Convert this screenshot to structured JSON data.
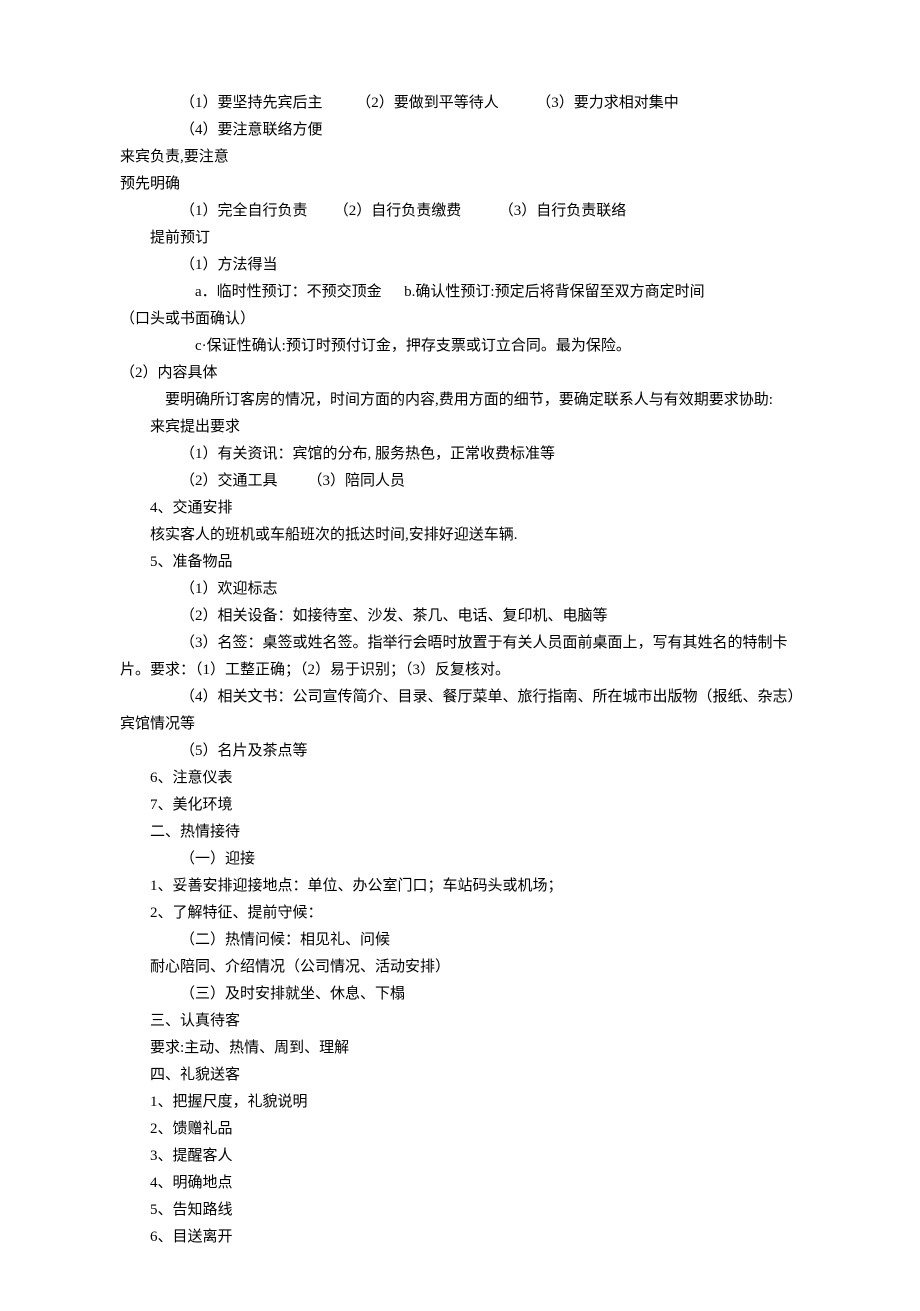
{
  "lines": [
    {
      "cls": "indent3",
      "text": "（1）要坚持先宾后主         （2）要做到平等待人          （3）要力求相对集中"
    },
    {
      "cls": "indent3",
      "text": "（4）要注意联络方便"
    },
    {
      "cls": "indent0",
      "text": "来宾负责,要注意"
    },
    {
      "cls": "indent0",
      "text": "预先明确"
    },
    {
      "cls": "indent3",
      "text": "（1）完全自行负责       （2）自行负责缴费          （3）自行负责联络"
    },
    {
      "cls": "indent1",
      "text": "提前预订"
    },
    {
      "cls": "indent3",
      "text": "（1）方法得当"
    },
    {
      "cls": "indent4",
      "text": "a．临时性预订：不预交顶金      b.确认性预订:预定后将背保留至双方商定时间"
    },
    {
      "cls": "indent0",
      "text": "（口头或书面确认）"
    },
    {
      "cls": "indent4",
      "text": "c·保证性确认:预订时预付订金，押存支票或订立合同。最为保险。"
    },
    {
      "cls": "indent0",
      "text": "（2）内容具体"
    },
    {
      "cls": "indent2",
      "text": "要明确所订客房的情况，时间方面的内容,费用方面的细节，要确定联系人与有效期要求协助:"
    },
    {
      "cls": "indent1",
      "text": "来宾提出要求"
    },
    {
      "cls": "indent3",
      "text": "（1）有关资讯：宾馆的分布, 服务热色，正常收费标准等"
    },
    {
      "cls": "indent3",
      "text": "（2）交通工具        （3）陪同人员"
    },
    {
      "cls": "indent1",
      "text": "4、交通安排"
    },
    {
      "cls": "indent1",
      "text": "核实客人的班机或车船班次的抵达时间,安排好迎送车辆."
    },
    {
      "cls": "indent1",
      "text": "5、准备物品"
    },
    {
      "cls": "indent3",
      "text": "（1）欢迎标志"
    },
    {
      "cls": "indent3",
      "text": "（2）相关设备：如接待室、沙发、茶几、电话、复印机、电脑等"
    },
    {
      "cls": "indent3",
      "text": "（3）名签：桌签或姓名签。指举行会晤时放置于有关人员面前桌面上，写有其姓名的特制卡"
    },
    {
      "cls": "indent0",
      "text": "片。要求：（1）工整正确；（2）易于识别；（3）反复核对。"
    },
    {
      "cls": "indent3",
      "text": "（4）相关文书：公司宣传简介、目录、餐厅菜单、旅行指南、所在城市出版物（报纸、杂志）"
    },
    {
      "cls": "indent0",
      "text": "宾馆情况等"
    },
    {
      "cls": "indent3",
      "text": "（5）名片及茶点等"
    },
    {
      "cls": "indent1",
      "text": "6、注意仪表"
    },
    {
      "cls": "indent1",
      "text": "7、美化环境"
    },
    {
      "cls": "indent1",
      "text": "二、热情接待"
    },
    {
      "cls": "indent3",
      "text": "（一）迎接"
    },
    {
      "cls": "indent1",
      "text": "1、妥善安排迎接地点：单位、办公室门口；车站码头或机场；"
    },
    {
      "cls": "indent1",
      "text": "2、了解特征、提前守候："
    },
    {
      "cls": "indent3",
      "text": "（二）热情问候：相见礼、问候"
    },
    {
      "cls": "indent1",
      "text": "耐心陪同、介绍情况（公司情况、活动安排）"
    },
    {
      "cls": "indent3",
      "text": "（三）及时安排就坐、休息、下榻"
    },
    {
      "cls": "indent1",
      "text": "三、认真待客"
    },
    {
      "cls": "indent1",
      "text": "要求:主动、热情、周到、理解"
    },
    {
      "cls": "indent1",
      "text": "四、礼貌送客"
    },
    {
      "cls": "indent1",
      "text": "1、把握尺度，礼貌说明"
    },
    {
      "cls": "indent1",
      "text": "2、馈赠礼品"
    },
    {
      "cls": "indent1",
      "text": "3、提醒客人"
    },
    {
      "cls": "indent1",
      "text": "4、明确地点"
    },
    {
      "cls": "indent1",
      "text": "5、告知路线"
    },
    {
      "cls": "indent1",
      "text": "6、目送离开"
    }
  ]
}
